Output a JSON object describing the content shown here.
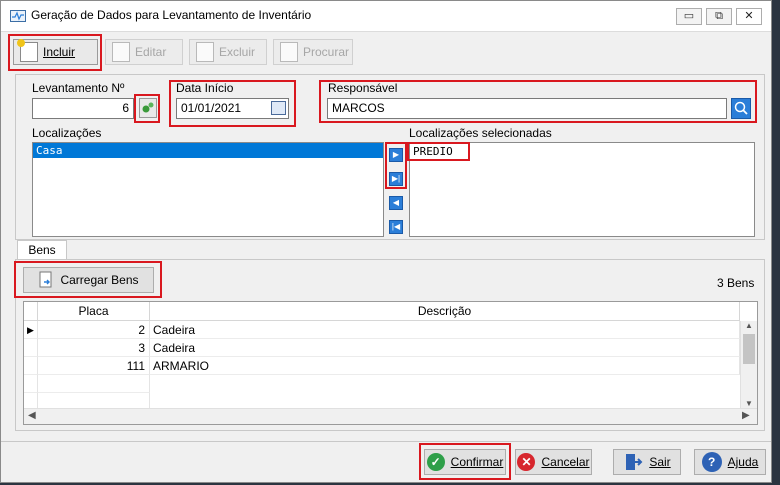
{
  "window": {
    "title": "Geração de Dados para Levantamento de Inventário",
    "controls": {
      "minimize": "▭",
      "restore": "⧉",
      "close": "✕"
    }
  },
  "toolbar": {
    "incluir": "Incluir",
    "editar": "Editar",
    "excluir": "Excluir",
    "procurar": "Procurar"
  },
  "form": {
    "levantamento_label": "Levantamento Nº",
    "levantamento_value": "6",
    "data_inicio_label": "Data Início",
    "data_inicio_value": "01/01/2021",
    "responsavel_label": "Responsável",
    "responsavel_value": "MARCOS",
    "localizacoes_label": "Localizações",
    "localizacoes_items": [
      "Casa"
    ],
    "selecionadas_label": "Localizações selecionadas",
    "selecionadas_items": [
      "PREDIO"
    ]
  },
  "tabs": {
    "bens": "Bens"
  },
  "bens": {
    "carregar_label": "Carregar Bens",
    "count_label": "3 Bens",
    "columns": {
      "placa": "Placa",
      "descricao": "Descrição"
    },
    "rows": [
      {
        "placa": "2",
        "descricao": "Cadeira"
      },
      {
        "placa": "3",
        "descricao": "Cadeira"
      },
      {
        "placa": "111",
        "descricao": "ARMARIO"
      }
    ]
  },
  "footer": {
    "confirmar": "Confirmar",
    "cancelar": "Cancelar",
    "sair": "Sair",
    "ajuda": "Ajuda"
  },
  "colors": {
    "highlight": "#d9181f",
    "selection": "#0078d7",
    "confirm_green": "#2e9f49",
    "cancel_red": "#d7262d",
    "help_blue": "#2e62b5"
  }
}
